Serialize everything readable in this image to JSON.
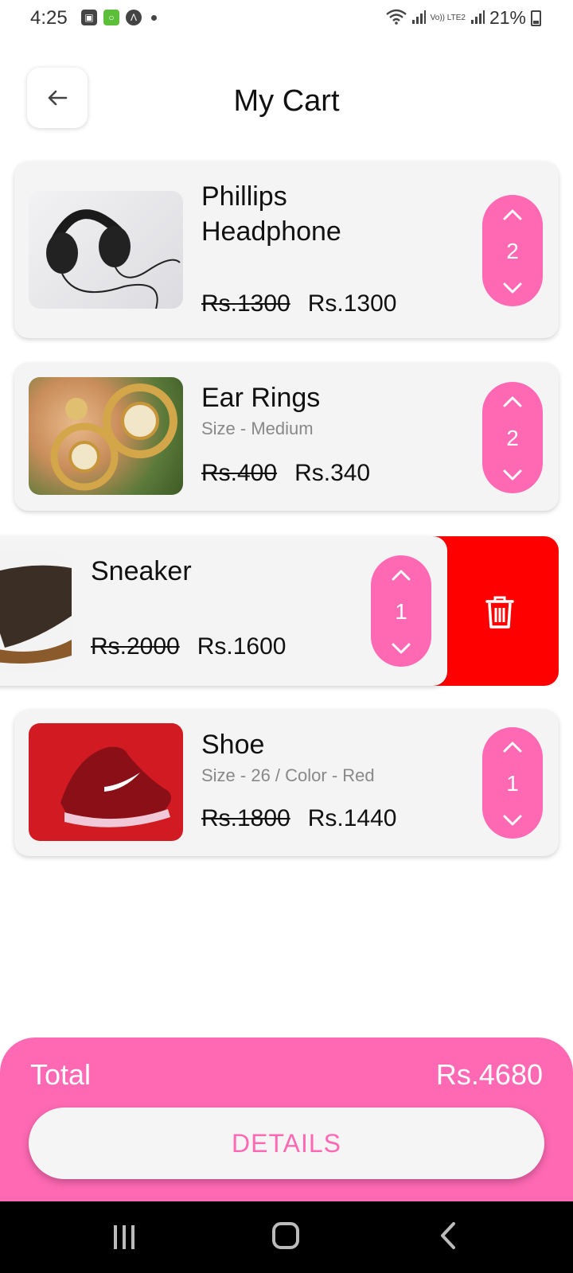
{
  "status_bar": {
    "time": "4:25",
    "battery": "21%",
    "lte_label": "Vo)) LTE2"
  },
  "header": {
    "title": "My Cart",
    "back_icon": "arrow-left-icon"
  },
  "cart_items": [
    {
      "name": "Phillips Headphone",
      "variant": "",
      "old_price": "Rs.1300",
      "price": "Rs.1300",
      "quantity": "2",
      "image": "black headphones"
    },
    {
      "name": "Ear Rings",
      "variant": "Size - Medium",
      "old_price": "Rs.400",
      "price": "Rs.340",
      "quantity": "2",
      "image": "gold earrings"
    },
    {
      "name": "Sneaker",
      "variant": "",
      "old_price": "Rs.2000",
      "price": "Rs.1600",
      "quantity": "1",
      "image": "sneaker",
      "swiped_to_delete": true
    },
    {
      "name": "Shoe",
      "variant": "Size - 26 / Color - Red",
      "old_price": "Rs.1800",
      "price": "Rs.1440",
      "quantity": "1",
      "image": "red running shoe"
    }
  ],
  "footer": {
    "total_label": "Total",
    "total_value": "Rs.4680",
    "details_label": "DETAILS"
  },
  "colors": {
    "accent": "#ff69b4",
    "delete": "#ff0000",
    "card_bg": "#f4f4f4"
  }
}
